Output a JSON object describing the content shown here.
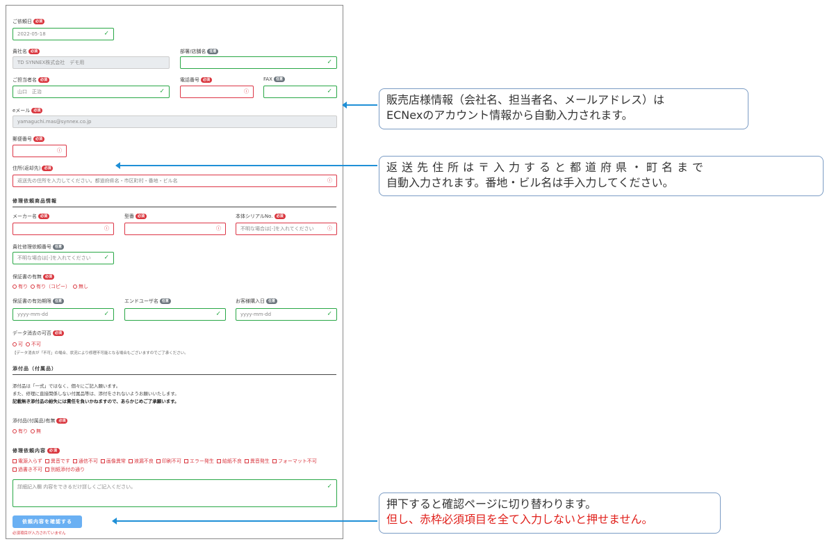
{
  "badges": {
    "required": "必須",
    "optional": "任意"
  },
  "fields": {
    "request_date": {
      "label": "ご依頼日",
      "value": "2022-05-18"
    },
    "company": {
      "label": "貴社名",
      "value": "TD SYNNEX株式会社　デモ用"
    },
    "department": {
      "label": "部署/店舗名",
      "value": ""
    },
    "contact": {
      "label": "ご担当者名",
      "value": "山口　正治"
    },
    "phone": {
      "label": "電話番号",
      "value": ""
    },
    "fax": {
      "label": "FAX",
      "value": ""
    },
    "email": {
      "label": "eメール",
      "value": "yamaguchi.mas@synnex.co.jp"
    },
    "postal": {
      "label": "郵便番号",
      "value": ""
    },
    "address": {
      "label": "住所(返却先)",
      "placeholder": "返送先の住所を入力してください。都道府県名・市区町村・番地・ビル名"
    }
  },
  "product_section": {
    "title": "修理依頼商品情報",
    "maker": {
      "label": "メーカー名",
      "value": ""
    },
    "model": {
      "label": "型番",
      "value": ""
    },
    "serial": {
      "label": "本体シリアルNo.",
      "placeholder": "不明な場合は[-]を入れてください"
    },
    "repair_no": {
      "label": "貴社修理依頼番号",
      "placeholder": "不明な場合は[-]を入れてください"
    },
    "warranty": {
      "label": "保証書の有無",
      "options": [
        "有り",
        "有り（コピー）",
        "無し"
      ]
    },
    "warranty_period": {
      "label": "保証書の有効期限",
      "placeholder": "yyyy-mm-dd"
    },
    "end_user": {
      "label": "エンドユーザ名",
      "value": ""
    },
    "purchase_date": {
      "label": "お客様購入日",
      "placeholder": "yyyy-mm-dd"
    },
    "data_erase": {
      "label": "データ消去の可否",
      "options": [
        "可",
        "不可"
      ],
      "note": "【データ消去が「不可」の場合、状況により修理不可能となる場合もございますのでご了承ください。"
    }
  },
  "accessory_section": {
    "title": "添付品（付属品）",
    "line1": "添付品は「一式」ではなく、個々にご記入願います。",
    "line2": "また、修理に直接関係しない付属品等は、添付をされないようお願いいたします。",
    "line3": "記載無き添付品の紛失には責任を負いかねますので、あらかじめご了承願います。",
    "presence": {
      "label": "添付品(付属品)有無",
      "options": [
        "有り",
        "無"
      ]
    }
  },
  "repair_section": {
    "title": "修理依頼内容",
    "options": [
      "電源入らず",
      "異音です",
      "通信不可",
      "画像異常",
      "液漏不良",
      "印刷不可",
      "エラー発生",
      "給紙不良",
      "異音発生",
      "フォーマット不可",
      "過書き不可",
      "別紙添付の通り"
    ],
    "detail_placeholder": "詳細記入欄 内容をできるだけ詳しくご記入ください。"
  },
  "submit": {
    "label": "依頼内容を確認する",
    "note": "必須項目が入力されていません"
  },
  "callouts": {
    "c1": {
      "line1": "販売店様情報（会社名、担当者名、メールアドレス）は",
      "line2": "ECNexのアカウント情報から自動入力されます。"
    },
    "c2": {
      "line1": "返送先住所は〒入力すると都道府県・町名まで",
      "line2": "自動入力されます。番地・ビル名は手入力してください。"
    },
    "c3": {
      "line1": "押下すると確認ページに切り替わります。",
      "line2": "但し、赤枠必須項目を全て入力しないと押せません。"
    }
  },
  "colors": {
    "accent": "#1f8fd6",
    "required": "#d9363e",
    "valid": "#28a745",
    "submit": "#6ab0f3"
  }
}
